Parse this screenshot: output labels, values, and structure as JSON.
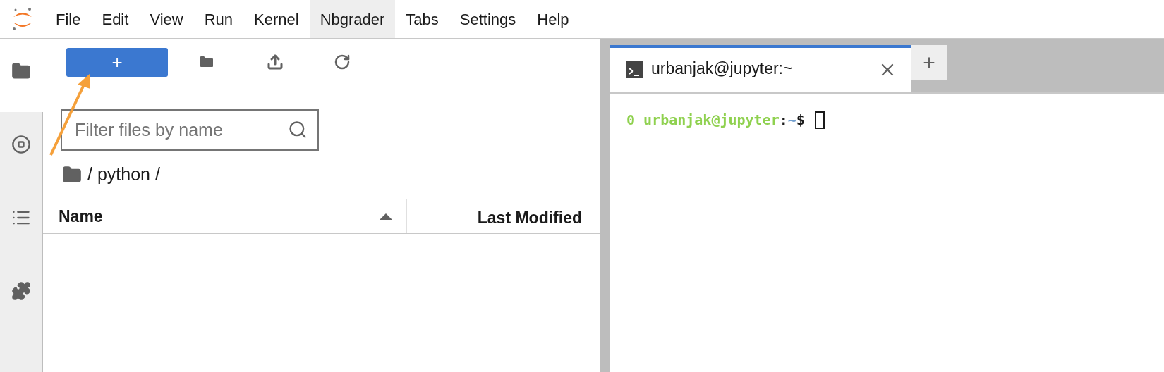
{
  "menu": [
    {
      "label": "File",
      "selected": false
    },
    {
      "label": "Edit",
      "selected": false
    },
    {
      "label": "View",
      "selected": false
    },
    {
      "label": "Run",
      "selected": false
    },
    {
      "label": "Kernel",
      "selected": false
    },
    {
      "label": "Nbgrader",
      "selected": true
    },
    {
      "label": "Tabs",
      "selected": false
    },
    {
      "label": "Settings",
      "selected": false
    },
    {
      "label": "Help",
      "selected": false
    }
  ],
  "sidebar_tabs": [
    {
      "kind": "folder",
      "selected": true
    },
    {
      "kind": "stop",
      "selected": false
    },
    {
      "kind": "list",
      "selected": false
    },
    {
      "kind": "puzzle",
      "selected": false
    }
  ],
  "file_browser": {
    "new_button": "+",
    "filter": {
      "placeholder": "Filter files by name"
    },
    "breadcrumb": "/ python /",
    "columns": [
      {
        "label": "Name",
        "sorted": true
      },
      {
        "label": "Last Modified",
        "sorted": false
      }
    ]
  },
  "terminal": {
    "tab": {
      "title": "urbanjak@jupyter:~",
      "selected": true
    },
    "add_tab": "+",
    "prompt": {
      "user": "0 urbanjak@jupyter",
      "separator": ":",
      "path": "~",
      "symbol": "$"
    }
  }
}
